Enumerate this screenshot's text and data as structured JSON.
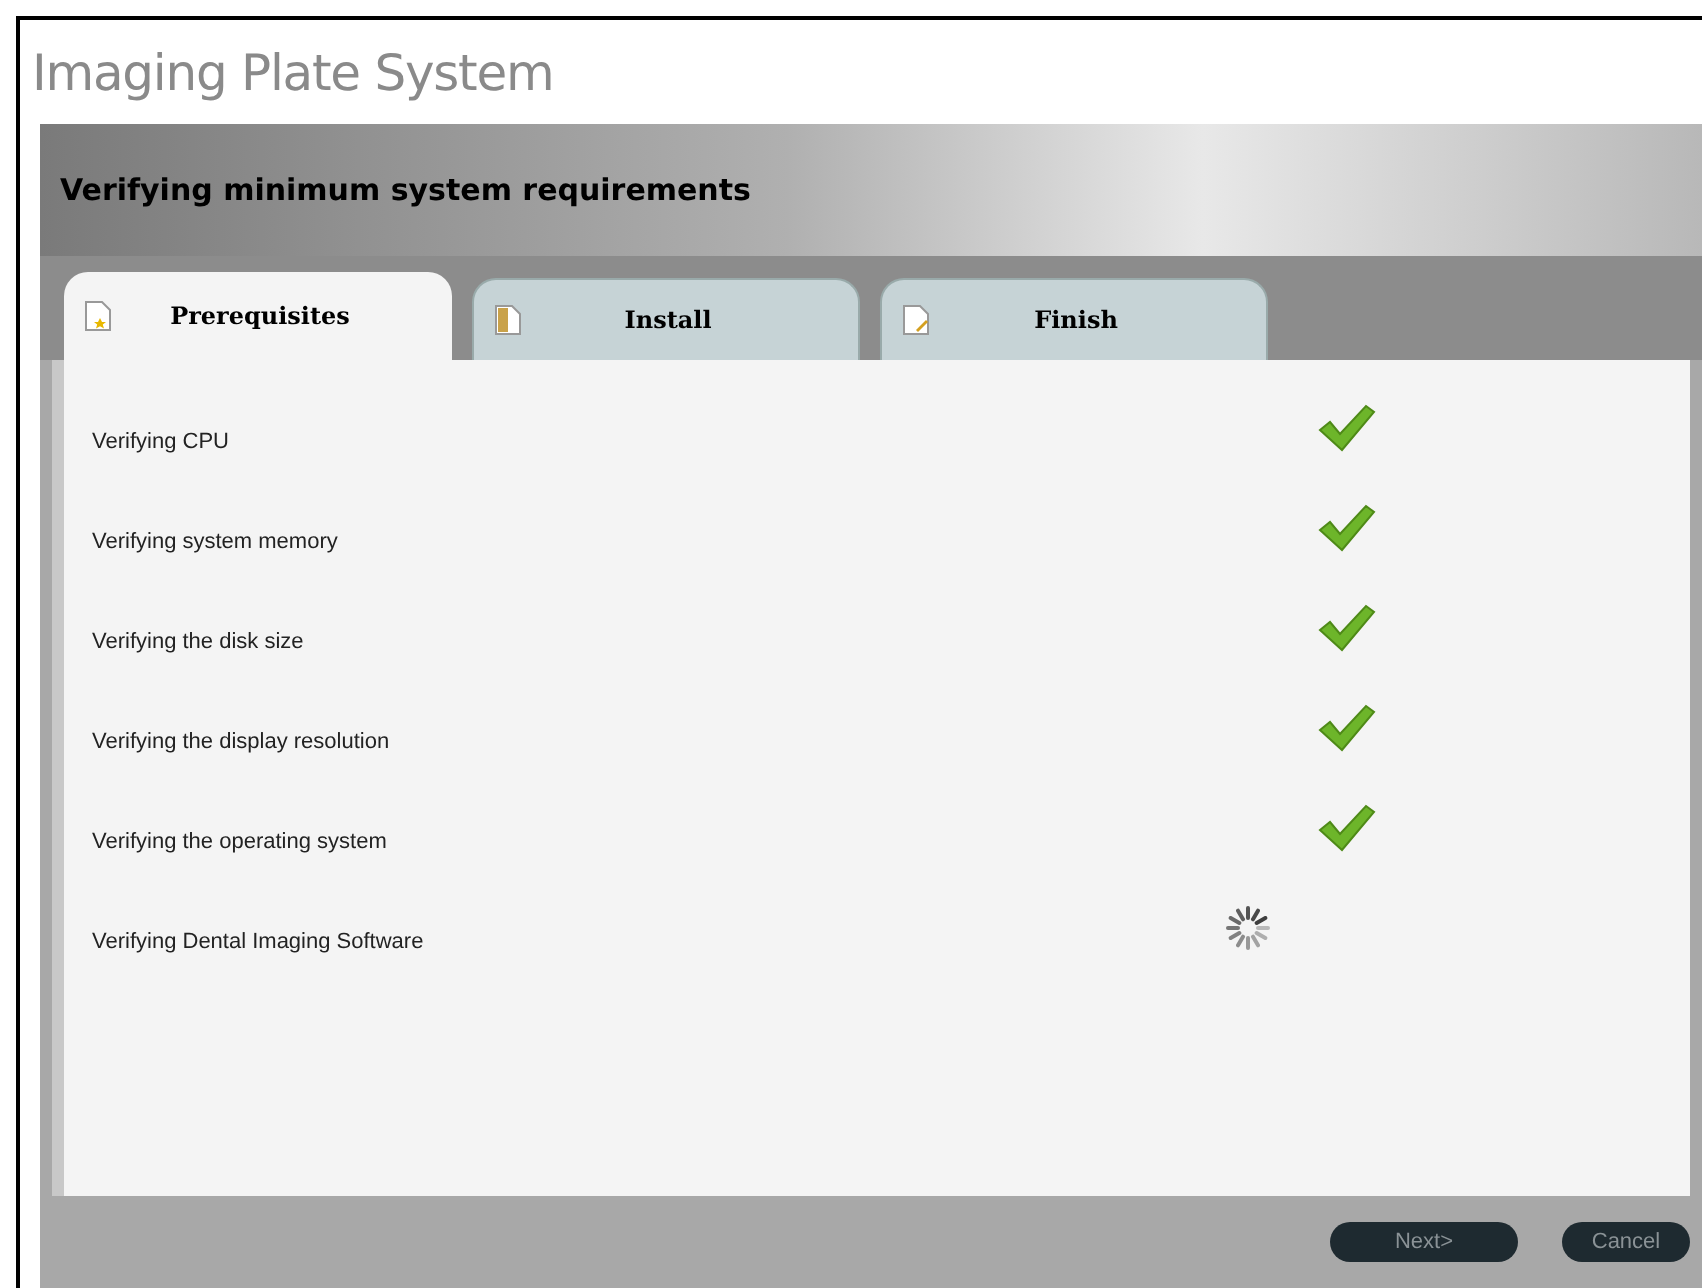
{
  "window": {
    "title": "Imaging Plate System"
  },
  "banner": {
    "heading": "Verifying minimum system requirements"
  },
  "tabs": [
    {
      "label": "Prerequisites",
      "selected": true
    },
    {
      "label": "Install",
      "selected": false
    },
    {
      "label": "Finish",
      "selected": false
    }
  ],
  "checks": [
    {
      "label": "Verifying CPU",
      "kind": "done"
    },
    {
      "label": "Verifying system memory",
      "kind": "done"
    },
    {
      "label": "Verifying the disk size",
      "kind": "done"
    },
    {
      "label": "Verifying the display resolution",
      "kind": "done"
    },
    {
      "label": "Verifying the operating system",
      "kind": "done"
    },
    {
      "label": "Verifying Dental Imaging Software",
      "kind": "running"
    }
  ],
  "buttons": [
    {
      "label": "Next>",
      "disabled": true
    },
    {
      "label": "Cancel",
      "disabled": true
    }
  ]
}
